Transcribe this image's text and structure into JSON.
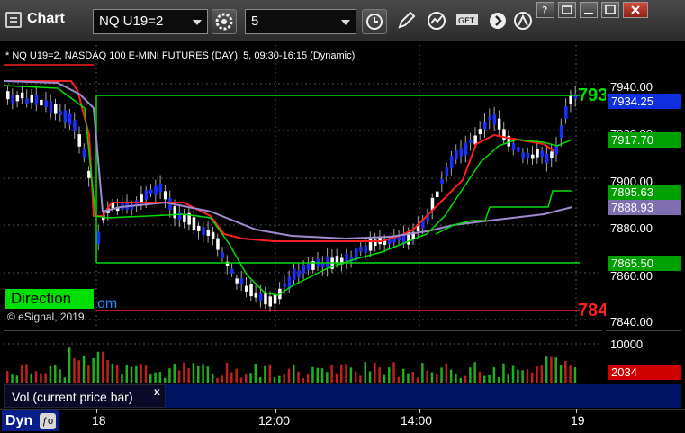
{
  "window": {
    "title": "Chart",
    "symbol": "NQ U19=2",
    "interval": "5"
  },
  "chart": {
    "label": "* NQ U19=2, NASDAQ 100 E-MINI FUTURES (DAY), 5, 09:30-16:15 (Dynamic)",
    "copyright": "© eSignal, 2019",
    "direction_label": "Direction",
    "direction_tail": "om",
    "right_label_green": "793",
    "right_label_red": "784"
  },
  "price_scale": {
    "ticks": [
      "7940.00",
      "7920.00",
      "7900.00",
      "7880.00",
      "7860.00",
      "7840.00"
    ],
    "tags": [
      {
        "value": "7934.25",
        "bg": "#1030e0"
      },
      {
        "value": "7917.70",
        "bg": "#00a000"
      },
      {
        "value": "7895.63",
        "bg": "#00a000"
      },
      {
        "value": "7888.93",
        "bg": "#7f6fb0"
      },
      {
        "value": "7865.50",
        "bg": "#00a000"
      }
    ]
  },
  "volume": {
    "legend": "Vol (current price bar)",
    "close_glyph": "x",
    "scale_tick": "10000",
    "current": "2034",
    "current_bg": "#d00000"
  },
  "bottom": {
    "tab": "Dyn",
    "icon_glyph": "ƒo",
    "time_labels": [
      "18",
      "12:00",
      "14:00",
      "19"
    ]
  },
  "colors": {
    "green": "#00e000",
    "red": "#ff2020",
    "purple": "#a08ad0",
    "candle_up": "#ffffff",
    "candle_down": "#1a30ff"
  }
}
